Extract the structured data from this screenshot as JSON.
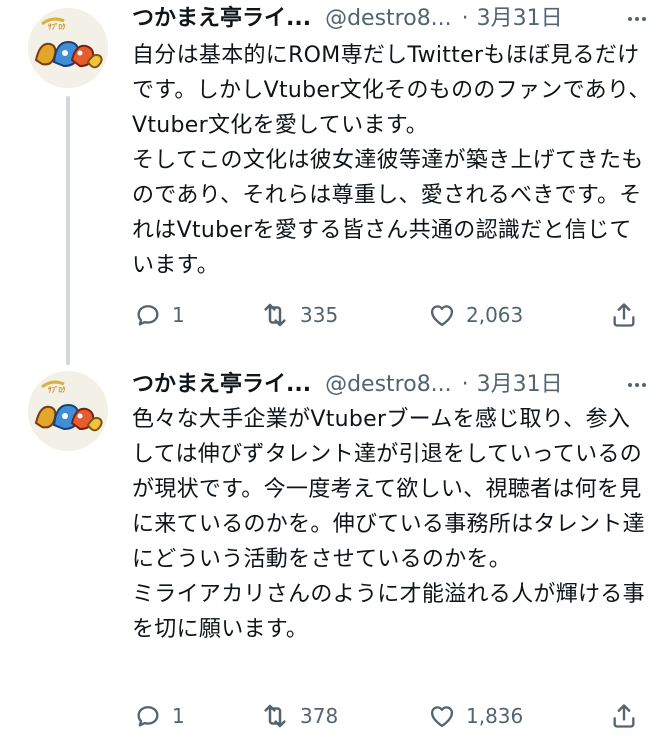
{
  "tweets": [
    {
      "display_name": "つかまえ亭ライ...",
      "handle": "@destro8...",
      "dot": "·",
      "date": "3月31日",
      "body": "自分は基本的にROM専だしTwitterもほぼ見るだけです。しかしVtuber文化そのもののファンであり、Vtuber文化を愛しています。\nそしてこの文化は彼女達彼等達が築き上げてきたものであり、それらは尊重し、愛されるべきです。それはVtuberを愛する皆さん共通の認識だと信じています。",
      "reply_count": "1",
      "retweet_count": "335",
      "like_count": "2,063"
    },
    {
      "display_name": "つかまえ亭ライ...",
      "handle": "@destro8...",
      "dot": "·",
      "date": "3月31日",
      "body": "色々な大手企業がVtuberブームを感じ取り、参入しては伸びずタレント達が引退をしていっているのが現状です。今一度考えて欲しい、視聴者は何を見に来ているのかを。伸びている事務所はタレント達にどういう活動をさせているのかを。\nミライアカリさんのように才能溢れる人が輝ける事を切に願います。",
      "reply_count": "1",
      "retweet_count": "378",
      "like_count": "1,836"
    }
  ],
  "icons": {
    "more": "more-horizontal-icon",
    "reply": "reply-bubble-icon",
    "retweet": "retweet-arrows-icon",
    "like": "heart-outline-icon",
    "share": "share-upload-icon"
  },
  "colors": {
    "text": "#0f1419",
    "secondary": "#536471",
    "thread_line": "#cfd9de"
  }
}
